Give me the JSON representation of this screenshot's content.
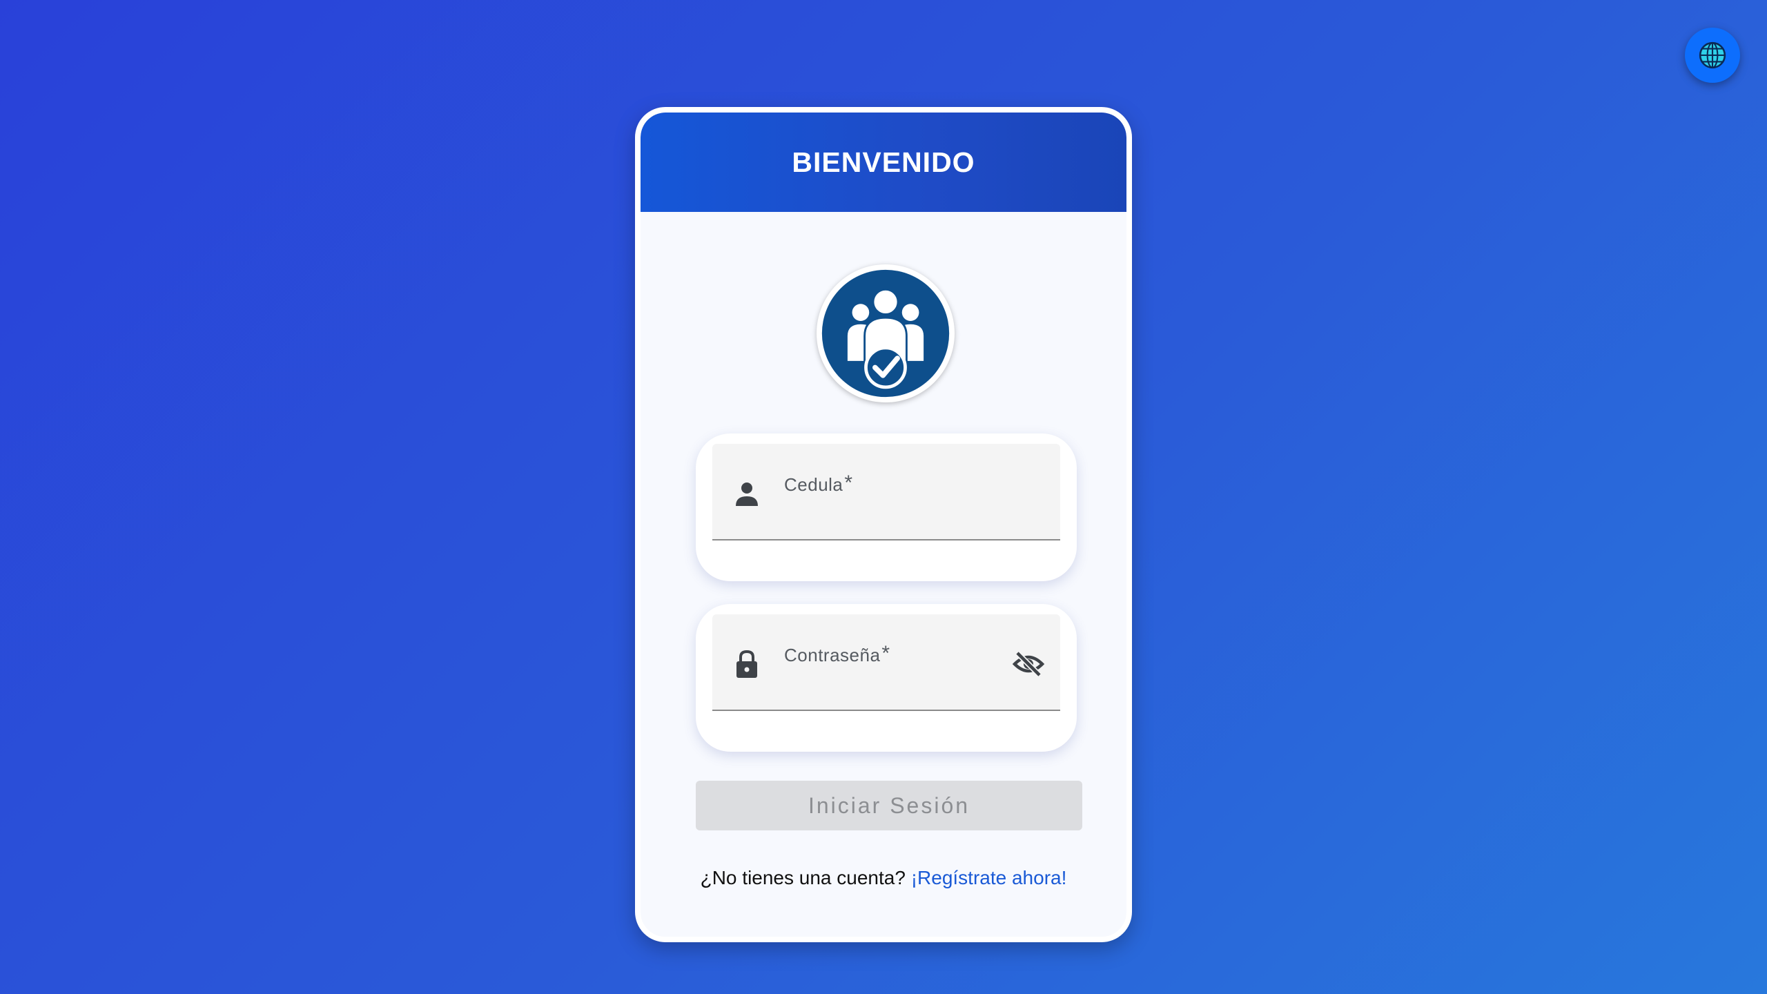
{
  "header": {
    "title": "BIENVENIDO"
  },
  "language_button": {
    "icon": "globe-icon"
  },
  "logo": {
    "icon": "users-check-icon",
    "color": "#0e4f8c"
  },
  "form": {
    "cedula": {
      "label": "Cedula",
      "required_mark": "*",
      "value": "",
      "icon": "person-icon"
    },
    "password": {
      "label": "Contraseña",
      "required_mark": "*",
      "value": "",
      "icon": "lock-icon",
      "toggle_icon": "eye-off-icon"
    },
    "submit_label": "Iniciar Sesión"
  },
  "footer": {
    "prompt": "¿No tienes una cuenta?",
    "link": "¡Regístrate ahora!"
  },
  "colors": {
    "header": "#1557d8",
    "accent": "#0d6efd",
    "link": "#1a5ad6",
    "button_disabled": "#dcdde0"
  }
}
